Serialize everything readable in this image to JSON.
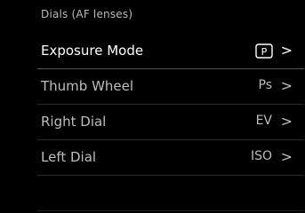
{
  "header": {
    "title": "Dials (AF lenses)"
  },
  "menu": {
    "items": [
      {
        "label": "Exposure Mode",
        "value": "P",
        "icon": "program-mode-icon",
        "selected": true
      },
      {
        "label": "Thumb Wheel",
        "value": "Ps",
        "selected": false
      },
      {
        "label": "Right Dial",
        "value": "EV",
        "selected": false
      },
      {
        "label": "Left Dial",
        "value": "ISO",
        "selected": false
      }
    ],
    "chevron": ">"
  },
  "colors": {
    "background": "#000000",
    "selection_underline": "#c8202a",
    "text_selected": "#ffffff",
    "text_normal": "#bdbdbd"
  }
}
